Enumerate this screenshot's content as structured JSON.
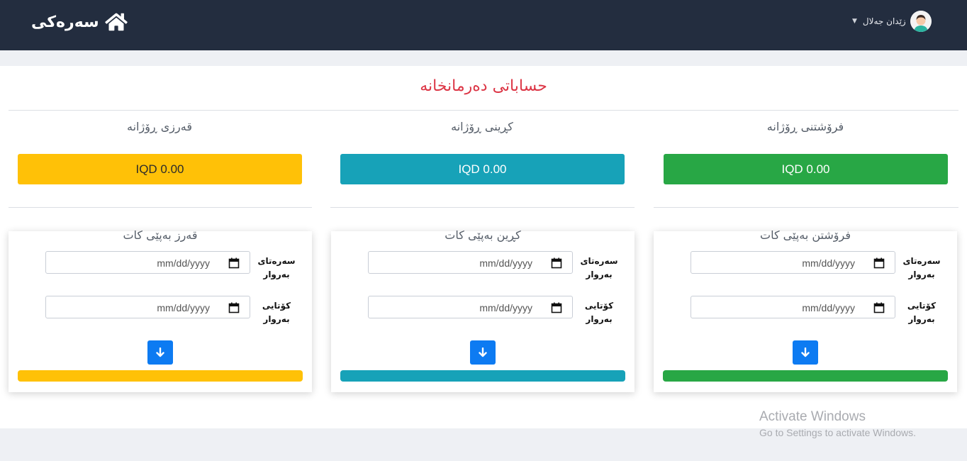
{
  "navbar": {
    "brand_label": "سەرەکی",
    "user_name": "زێدان جەلال"
  },
  "page": {
    "title": "حساباتی دەرمانخانە"
  },
  "summary": [
    {
      "heading": "فرۆشتنی ڕۆژانە",
      "amount": "IQD 0.00",
      "color": "#28a745"
    },
    {
      "heading": "کڕینی ڕۆژانە",
      "amount": "IQD 0.00",
      "color": "#17a2b8"
    },
    {
      "heading": "قەرزی ڕۆژانە",
      "amount": "IQD 0.00",
      "color": "#ffc107"
    }
  ],
  "cards": [
    {
      "title": "فرۆشتن بەپێی کات",
      "color": "#28a745"
    },
    {
      "title": "کڕین بەپێی کات",
      "color": "#17a2b8"
    },
    {
      "title": "قەرز بەپێی کات",
      "color": "#ffc107"
    }
  ],
  "form": {
    "start_label_line1": "سەرەتای",
    "start_label_line2": "بەروار",
    "end_label_line1": "کۆتایی",
    "end_label_line2": "بەروار",
    "date_placeholder": "mm/dd/yyyy"
  },
  "watermark": {
    "line1": "Activate Windows",
    "line2": "Go to Settings to activate Windows."
  }
}
